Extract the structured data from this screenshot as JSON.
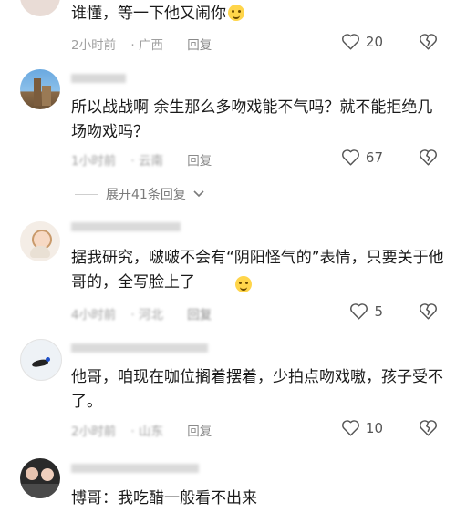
{
  "comments": [
    {
      "text": "谁懂，等一下他又闹你",
      "time": "2小时前",
      "location": "广西",
      "reply": "回复",
      "likes": "20"
    },
    {
      "text": "所以战战啊 余生那么多吻戏能不气吗？就不能拒绝几场吻戏吗？",
      "time": "1小时前",
      "location": "云南",
      "reply": "回复",
      "likes": "67"
    },
    {
      "text": "据我研究，啵啵不会有“阴阳怪气的”表情，只要关于他哥的，全写脸上了",
      "time": "4小时前",
      "location": "河北",
      "reply": "回复",
      "likes": "5"
    },
    {
      "text": "他哥，咱现在咖位搁着摆着，少拍点吻戏嗷，孩子受不了。",
      "time": "2小时前",
      "location": "山东",
      "reply": "回复",
      "likes": "10"
    },
    {
      "text": "博哥：我吃醋一般看不出来"
    }
  ],
  "expand_replies": "展开41条回复"
}
